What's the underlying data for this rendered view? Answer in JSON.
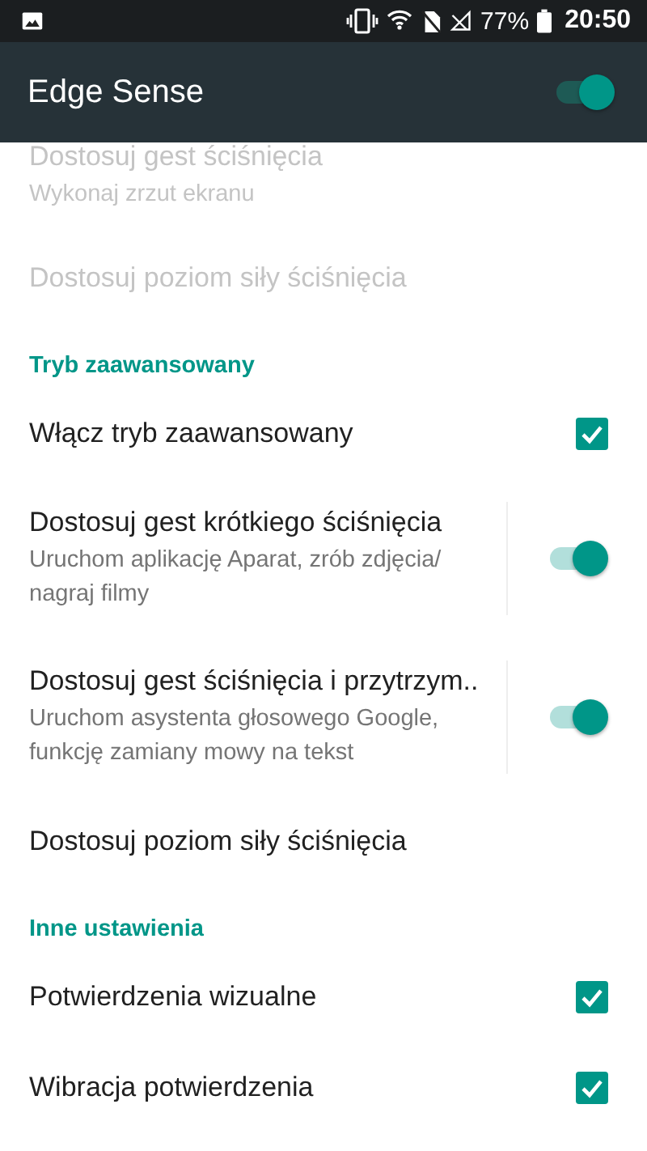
{
  "status_bar": {
    "battery": "77%",
    "time": "20:50"
  },
  "toolbar": {
    "title": "Edge Sense",
    "on": true
  },
  "items": [
    {
      "kind": "plain",
      "title": "Dostosuj gest ściśnięcia",
      "summary": "Wykonaj zrzut ekranu",
      "disabled": true
    },
    {
      "kind": "plain",
      "title": "Dostosuj poziom siły ściśnięcia",
      "disabled": true
    },
    {
      "kind": "header",
      "title": "Tryb zaawansowany"
    },
    {
      "kind": "checkbox",
      "title": "Włącz tryb zaawansowany",
      "checked": true,
      "disabled": false
    },
    {
      "kind": "switch",
      "title": "Dostosuj gest krótkiego ściśnięcia",
      "summary": "Uruchom aplikację Aparat, zrób zdjęcia/ nagraj filmy",
      "on": true,
      "disabled": false
    },
    {
      "kind": "switch",
      "title": "Dostosuj gest ściśnięcia i przytrzym..",
      "summary": "Uruchom asystenta głosowego Google, funkcję zamiany mowy na tekst",
      "on": true,
      "disabled": false
    },
    {
      "kind": "plain",
      "title": "Dostosuj poziom siły ściśnięcia",
      "disabled": false
    },
    {
      "kind": "header",
      "title": "Inne ustawienia"
    },
    {
      "kind": "checkbox",
      "title": "Potwierdzenia wizualne",
      "checked": true,
      "disabled": false
    },
    {
      "kind": "checkbox",
      "title": "Wibracja potwierdzenia",
      "checked": true,
      "disabled": false
    }
  ]
}
